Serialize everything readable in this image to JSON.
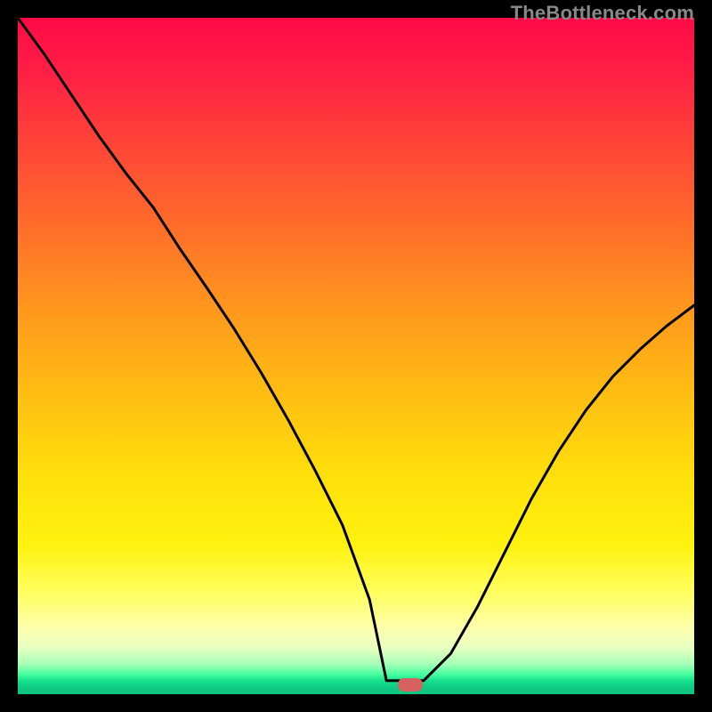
{
  "watermark": "TheBottleneck.com",
  "marker": {
    "color": "#d6615f",
    "x_frac": 0.58,
    "y_frac": 0.985
  },
  "chart_data": {
    "type": "line",
    "title": "",
    "xlabel": "",
    "ylabel": "",
    "xlim": [
      0,
      1
    ],
    "ylim": [
      0,
      1
    ],
    "background_gradient": {
      "top": "#ff0a46",
      "mid1": "#ff941e",
      "mid2": "#ffe00b",
      "mid3": "#ffff60",
      "bottom": "#0fc482"
    },
    "series": [
      {
        "name": "bottleneck-curve",
        "x": [
          0.0,
          0.04,
          0.08,
          0.12,
          0.16,
          0.2,
          0.24,
          0.28,
          0.32,
          0.36,
          0.4,
          0.44,
          0.48,
          0.52,
          0.545,
          0.56,
          0.6,
          0.64,
          0.68,
          0.72,
          0.76,
          0.8,
          0.84,
          0.88,
          0.92,
          0.96,
          1.0
        ],
        "y": [
          1.0,
          0.945,
          0.885,
          0.825,
          0.77,
          0.72,
          0.658,
          0.6,
          0.54,
          0.475,
          0.405,
          0.33,
          0.25,
          0.14,
          0.02,
          0.02,
          0.02,
          0.06,
          0.13,
          0.21,
          0.29,
          0.36,
          0.42,
          0.47,
          0.51,
          0.545,
          0.575
        ]
      }
    ],
    "annotations": [
      {
        "type": "marker",
        "shape": "rounded-rect",
        "x": 0.58,
        "y": 0.015,
        "color": "#d6615f"
      }
    ]
  }
}
